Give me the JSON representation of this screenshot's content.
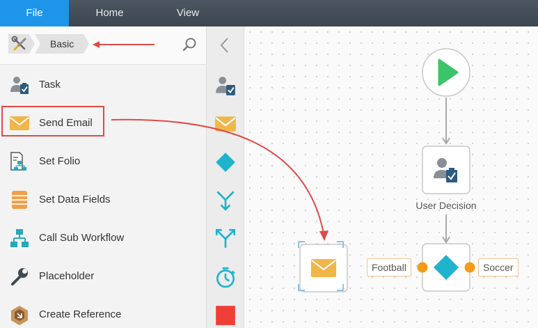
{
  "menu": {
    "tabs": [
      {
        "label": "File",
        "active": true
      },
      {
        "label": "Home",
        "active": false
      },
      {
        "label": "View",
        "active": false
      }
    ]
  },
  "toolbox": {
    "breadcrumb": "Basic",
    "items": [
      {
        "label": "Task",
        "icon": "task-icon"
      },
      {
        "label": "Send Email",
        "icon": "envelope-icon",
        "highlighted": true
      },
      {
        "label": "Set Folio",
        "icon": "folio-icon"
      },
      {
        "label": "Set Data Fields",
        "icon": "data-fields-icon"
      },
      {
        "label": "Call Sub Workflow",
        "icon": "sub-workflow-icon"
      },
      {
        "label": "Placeholder",
        "icon": "wrench-icon"
      },
      {
        "label": "Create Reference",
        "icon": "reference-icon"
      }
    ]
  },
  "workflow": {
    "nodes": {
      "decision_label": "User Decision"
    },
    "outcomes": {
      "left": "Football",
      "right": "Soccer"
    }
  },
  "colors": {
    "accent": "#1e95e8",
    "annotation": "#e04a46",
    "email": "#f0b64a",
    "diamond": "#1fb3cd",
    "start": "#3cc46a",
    "outcome_dot": "#f49b1a"
  }
}
